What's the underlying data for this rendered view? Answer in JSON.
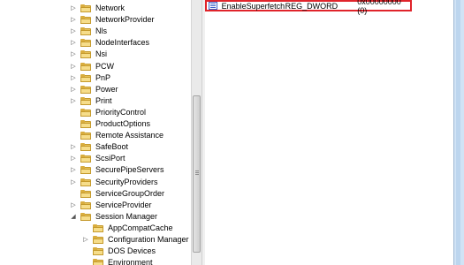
{
  "tree": {
    "items": [
      {
        "label": "Network",
        "depth": 0,
        "expander": "▷"
      },
      {
        "label": "NetworkProvider",
        "depth": 0,
        "expander": "▷"
      },
      {
        "label": "Nls",
        "depth": 0,
        "expander": "▷"
      },
      {
        "label": "NodeInterfaces",
        "depth": 0,
        "expander": "▷"
      },
      {
        "label": "Nsi",
        "depth": 0,
        "expander": "▷"
      },
      {
        "label": "PCW",
        "depth": 0,
        "expander": "▷"
      },
      {
        "label": "PnP",
        "depth": 0,
        "expander": "▷"
      },
      {
        "label": "Power",
        "depth": 0,
        "expander": "▷"
      },
      {
        "label": "Print",
        "depth": 0,
        "expander": "▷"
      },
      {
        "label": "PriorityControl",
        "depth": 0,
        "expander": ""
      },
      {
        "label": "ProductOptions",
        "depth": 0,
        "expander": ""
      },
      {
        "label": "Remote Assistance",
        "depth": 0,
        "expander": ""
      },
      {
        "label": "SafeBoot",
        "depth": 0,
        "expander": "▷"
      },
      {
        "label": "ScsiPort",
        "depth": 0,
        "expander": "▷"
      },
      {
        "label": "SecurePipeServers",
        "depth": 0,
        "expander": "▷"
      },
      {
        "label": "SecurityProviders",
        "depth": 0,
        "expander": "▷"
      },
      {
        "label": "ServiceGroupOrder",
        "depth": 0,
        "expander": ""
      },
      {
        "label": "ServiceProvider",
        "depth": 0,
        "expander": "▷"
      },
      {
        "label": "Session Manager",
        "depth": 0,
        "expander": "◢"
      },
      {
        "label": "AppCompatCache",
        "depth": 1,
        "expander": ""
      },
      {
        "label": "Configuration Manager",
        "depth": 1,
        "expander": "▷"
      },
      {
        "label": "DOS Devices",
        "depth": 1,
        "expander": ""
      },
      {
        "label": "Environment",
        "depth": 1,
        "expander": ""
      }
    ]
  },
  "values": {
    "selected": {
      "name": "EnableSuperfetch",
      "type": "REG_DWORD",
      "data": "0x00000000 (0)",
      "icon": "reg-binary-icon"
    }
  },
  "colors": {
    "highlight_border": "#e0242b",
    "folder": "#e7c25a",
    "window_frame": "#d1e3f5"
  }
}
